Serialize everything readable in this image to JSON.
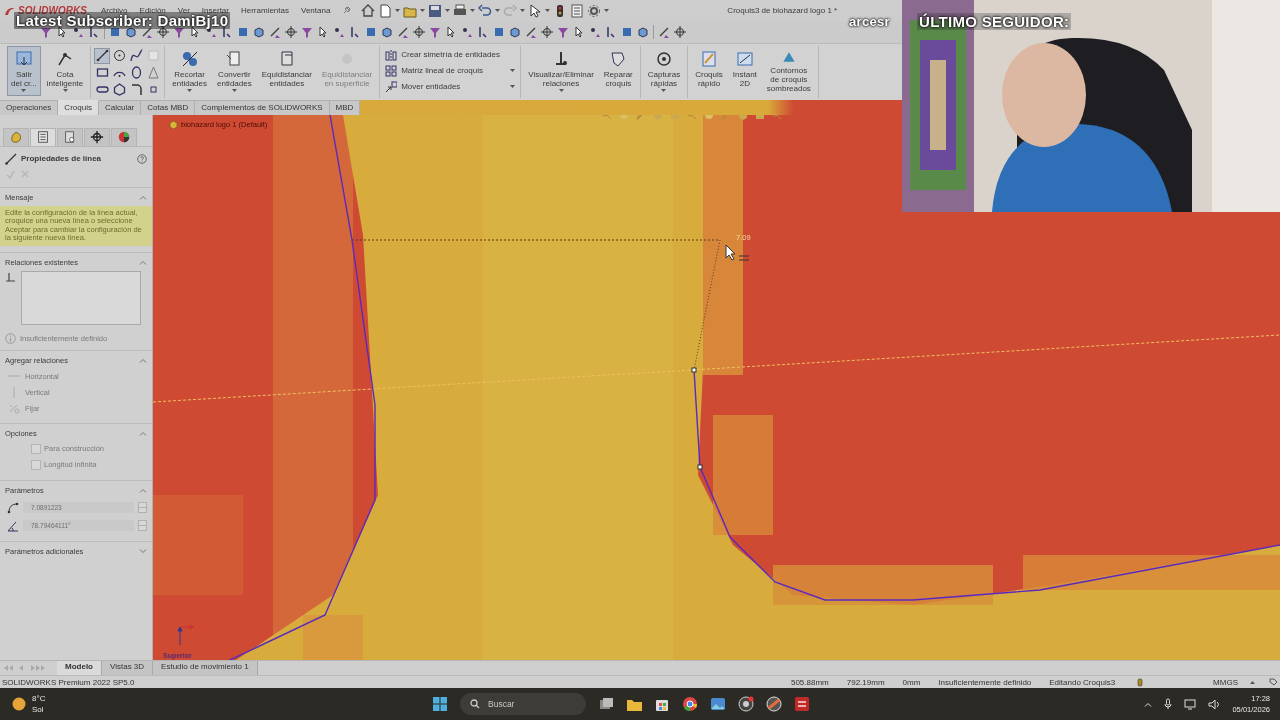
{
  "overlay": {
    "subscriber": "Latest Subscriber: DamiBj10",
    "ticker": "arcesr",
    "follower_label": "ÚLTIMO SEGUIDOR:"
  },
  "title_bar": {
    "logo": "SOLIDWORKS",
    "menus": [
      "Archivo",
      "Edición",
      "Ver",
      "Insertar",
      "Herramientas",
      "Ventana"
    ],
    "document_title": "Croquis3 de biohazard logo 1 *"
  },
  "ribbon_groups": [
    {
      "kind": "buttons",
      "items": [
        {
          "label": "Salir\ndel cr...",
          "selected": true,
          "disabled": false,
          "dropdown": true
        },
        {
          "label": "Cota\ninteligente",
          "selected": false,
          "disabled": false,
          "dropdown": true
        }
      ]
    },
    {
      "kind": "tools",
      "items": [
        {
          "kind": "line",
          "selected": true
        },
        {
          "kind": "circle",
          "selected": false
        },
        {
          "kind": "spline",
          "selected": false
        },
        {
          "kind": "plane",
          "selected": false
        },
        {
          "kind": "rectangle",
          "selected": false
        },
        {
          "kind": "arc",
          "selected": false
        },
        {
          "kind": "ellipse",
          "selected": false
        },
        {
          "kind": "text",
          "selected": false
        },
        {
          "kind": "slot",
          "selected": false
        },
        {
          "kind": "polygon",
          "selected": false
        },
        {
          "kind": "fillet",
          "selected": false
        },
        {
          "kind": "point",
          "selected": false
        }
      ]
    },
    {
      "kind": "buttons",
      "items": [
        {
          "label": "Recortar\nentidades",
          "selected": false,
          "disabled": false,
          "dropdown": true
        },
        {
          "label": "Convertir\nentidades",
          "selected": false,
          "disabled": false,
          "dropdown": true
        },
        {
          "label": "Equidistanciar\nentidades",
          "selected": false,
          "disabled": false,
          "dropdown": false
        },
        {
          "label": "Equidistanciar\nen superficie",
          "selected": false,
          "disabled": true,
          "dropdown": false
        }
      ]
    },
    {
      "kind": "list",
      "items": [
        {
          "label": "Crear simetría de entidades",
          "dropdown": false
        },
        {
          "label": "Matriz lineal de croquis",
          "dropdown": true
        },
        {
          "label": "Mover entidades",
          "dropdown": true
        }
      ]
    },
    {
      "kind": "buttons",
      "items": [
        {
          "label": "Visualizar/Eliminar\nrelaciones",
          "selected": false,
          "disabled": false,
          "dropdown": true
        },
        {
          "label": "Reparar\ncroquis",
          "selected": false,
          "disabled": false,
          "dropdown": false
        }
      ]
    },
    {
      "kind": "buttons",
      "items": [
        {
          "label": "Capturas\nrápidas",
          "selected": false,
          "disabled": false,
          "dropdown": true
        }
      ]
    },
    {
      "kind": "buttons",
      "items": [
        {
          "label": "Croquis\nrápido",
          "selected": false,
          "disabled": false,
          "dropdown": false
        },
        {
          "label": "Instant\n2D",
          "selected": false,
          "disabled": false,
          "dropdown": false
        },
        {
          "label": "Contornos\nde croquis\nsombreados",
          "selected": false,
          "disabled": false,
          "dropdown": false
        }
      ]
    }
  ],
  "ribbon_tabs": [
    {
      "label": "Operaciones",
      "selected": false
    },
    {
      "label": "Croquis",
      "selected": true
    },
    {
      "label": "Calcular",
      "selected": false
    },
    {
      "label": "Cotas MBD",
      "selected": false
    },
    {
      "label": "Complementos de SOLIDWORKS",
      "selected": false
    },
    {
      "label": "MBD",
      "selected": false
    }
  ],
  "panel": {
    "tabs": [
      {
        "selected": false
      },
      {
        "selected": true
      },
      {
        "selected": false
      },
      {
        "selected": false
      },
      {
        "selected": false
      }
    ],
    "title": "Propiedades de línea",
    "sections": [
      {
        "kind": "message",
        "title": "Mensaje",
        "expanded": true,
        "text": "Edite la configuración de la línea actual, croquice una nueva línea o seleccione Aceptar para cambiar la configuración de la siguiente nueva línea."
      },
      {
        "kind": "relations",
        "title": "Relaciones existentes",
        "expanded": true,
        "status": "Insuficientemente definido"
      },
      {
        "kind": "add",
        "title": "Agregar relaciones",
        "expanded": true,
        "items": [
          {
            "kind": "horizontal",
            "label": "Horizontal",
            "disabled": true
          },
          {
            "kind": "vertical",
            "label": "Vertical",
            "disabled": true
          },
          {
            "kind": "fix",
            "label": "Fijar",
            "disabled": true
          }
        ]
      },
      {
        "kind": "options",
        "title": "Opciones",
        "expanded": true,
        "items": [
          {
            "label": "Para construcción",
            "checked": false
          },
          {
            "label": "Longitud infinita",
            "checked": false
          }
        ]
      },
      {
        "kind": "params",
        "title": "Parámetros",
        "expanded": true,
        "items": [
          {
            "kind": "length",
            "value": "7.0891223"
          },
          {
            "kind": "angle",
            "value": "78.79464111°"
          }
        ]
      },
      {
        "kind": "empty",
        "title": "Parámetros adicionales",
        "expanded": false
      }
    ]
  },
  "canvas": {
    "tree_item": "biohazard logo 1 (Default)",
    "dimension": "7.09",
    "view_label": "Superior"
  },
  "bottom_tabs": [
    {
      "label": "Modelo",
      "selected": true
    },
    {
      "label": "Vistas 3D",
      "selected": false
    },
    {
      "label": "Estudio de movimiento 1",
      "selected": false
    }
  ],
  "status_bar": {
    "product": "SOLIDWORKS Premium 2022 SP5.0",
    "fields": [
      "505.88mm",
      "792.19mm",
      "0mm",
      "Insuficientemente definido",
      "Editando Croquis3"
    ],
    "units": "MMGS"
  },
  "taskbar": {
    "temperature": "8°C",
    "weather": "Sol",
    "search_placeholder": "Buscar",
    "time": "17:28",
    "date": "05/01/2026"
  }
}
